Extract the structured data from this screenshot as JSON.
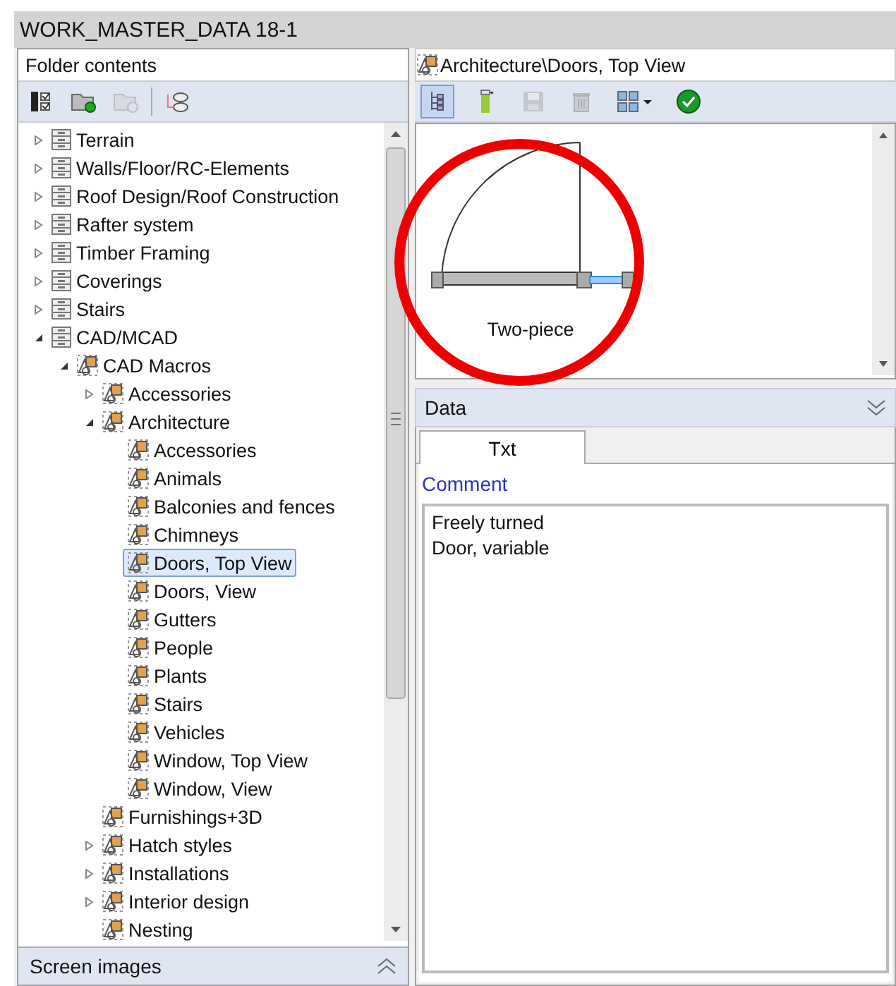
{
  "window": {
    "title": "WORK_MASTER_DATA 18-1"
  },
  "left_panel": {
    "title": "Folder contents",
    "toolbar_groups": [
      [
        {
          "kind": "checklist",
          "disabled": false
        },
        {
          "kind": "new-folder",
          "disabled": false
        },
        {
          "kind": "copy-folder",
          "disabled": true
        }
      ],
      [
        {
          "kind": "connect",
          "disabled": false
        }
      ]
    ],
    "tree": [
      {
        "label": "Terrain",
        "kind": "drawer",
        "expanded": false,
        "selected": false
      },
      {
        "label": "Walls/Floor/RC-Elements",
        "kind": "drawer",
        "expanded": false,
        "selected": false
      },
      {
        "label": "Roof Design/Roof Construction",
        "kind": "drawer",
        "expanded": false,
        "selected": false
      },
      {
        "label": "Rafter system",
        "kind": "drawer",
        "expanded": false,
        "selected": false
      },
      {
        "label": "Timber Framing",
        "kind": "drawer",
        "expanded": false,
        "selected": false
      },
      {
        "label": "Coverings",
        "kind": "drawer",
        "expanded": false,
        "selected": false
      },
      {
        "label": "Stairs",
        "kind": "drawer",
        "expanded": false,
        "selected": false
      },
      {
        "label": "CAD/MCAD",
        "kind": "drawer",
        "expanded": true,
        "selected": false,
        "children": [
          {
            "label": "CAD Macros",
            "kind": "macro",
            "expanded": true,
            "selected": false,
            "children": [
              {
                "label": "Accessories",
                "kind": "macro",
                "expanded": false,
                "selected": false
              },
              {
                "label": "Architecture",
                "kind": "macro",
                "expanded": true,
                "selected": false,
                "children": [
                  {
                    "label": "Accessories",
                    "kind": "macro",
                    "selected": false
                  },
                  {
                    "label": "Animals",
                    "kind": "macro",
                    "selected": false
                  },
                  {
                    "label": "Balconies and fences",
                    "kind": "macro",
                    "selected": false
                  },
                  {
                    "label": "Chimneys",
                    "kind": "macro",
                    "selected": false
                  },
                  {
                    "label": "Doors, Top View",
                    "kind": "macro",
                    "selected": true
                  },
                  {
                    "label": "Doors, View",
                    "kind": "macro",
                    "selected": false
                  },
                  {
                    "label": "Gutters",
                    "kind": "macro",
                    "selected": false
                  },
                  {
                    "label": "People",
                    "kind": "macro",
                    "selected": false
                  },
                  {
                    "label": "Plants",
                    "kind": "macro",
                    "selected": false
                  },
                  {
                    "label": "Stairs",
                    "kind": "macro",
                    "selected": false
                  },
                  {
                    "label": "Vehicles",
                    "kind": "macro",
                    "selected": false
                  },
                  {
                    "label": "Window, Top View",
                    "kind": "macro",
                    "selected": false
                  },
                  {
                    "label": "Window, View",
                    "kind": "macro",
                    "selected": false
                  }
                ]
              },
              {
                "label": "Furnishings+3D",
                "kind": "macro",
                "selected": false
              },
              {
                "label": "Hatch styles",
                "kind": "macro",
                "expanded": false,
                "selected": false
              },
              {
                "label": "Installations",
                "kind": "macro",
                "expanded": false,
                "selected": false
              },
              {
                "label": "Interior design",
                "kind": "macro",
                "expanded": false,
                "selected": false
              },
              {
                "label": "Nesting",
                "kind": "macro",
                "selected": false
              }
            ]
          }
        ]
      }
    ],
    "footer": {
      "title": "Screen images",
      "expanded": false
    }
  },
  "right_panel": {
    "path": "Architecture\\Doors, Top View",
    "toolbar": [
      {
        "kind": "tree",
        "pressed": true,
        "disabled": false
      },
      {
        "kind": "pen",
        "pressed": false,
        "disabled": false
      },
      {
        "kind": "save",
        "pressed": false,
        "disabled": true
      },
      {
        "kind": "delete",
        "pressed": false,
        "disabled": true
      },
      {
        "kind": "grid",
        "pressed": false,
        "disabled": false
      },
      {
        "kind": "apply",
        "pressed": false,
        "disabled": false
      }
    ],
    "previews": [
      {
        "caption": "Two-piece",
        "selected": false
      }
    ],
    "data": {
      "title": "Data",
      "expanded": true,
      "tabs": [
        {
          "label": "Txt",
          "selected": true
        }
      ],
      "comment_label": "Comment",
      "comment": "Freely turned\nDoor, variable"
    }
  }
}
